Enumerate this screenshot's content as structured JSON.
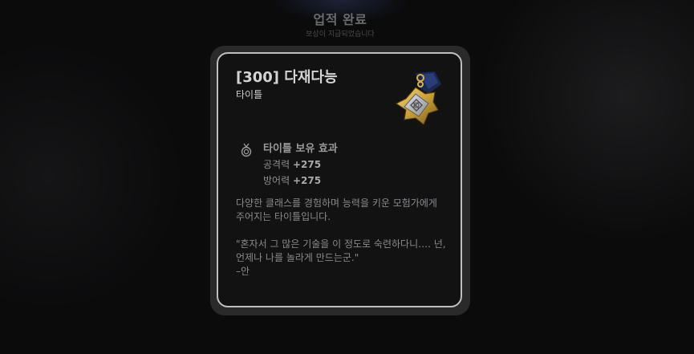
{
  "header": {
    "title": "업적 완료",
    "subtitle": "보상이 지급되었습니다"
  },
  "card": {
    "title": "[300] 다재다능",
    "type": "타이틀",
    "medal_icon": "medal-icon",
    "effect": {
      "icon": "medal-ribbon-icon",
      "title": "타이틀 보유 효과",
      "stats": [
        {
          "label": "공격력",
          "value": "+275"
        },
        {
          "label": "방어력",
          "value": "+275"
        }
      ]
    },
    "description": [
      "다양한 클래스를 경험하며 능력을 키운 모험가에게",
      "주어지는 타이틀입니다."
    ],
    "quote": [
      "\"혼자서 그 많은 기술을 이 정도로 숙련하다니…. 넌,",
      "언제나 나를 놀라게 만드는군.\"",
      "–안"
    ]
  },
  "colors": {
    "card_border": "#bfbfc0",
    "card_bg": "#121213",
    "medal_gold": "#c9a13a",
    "medal_navy": "#1b2850"
  }
}
